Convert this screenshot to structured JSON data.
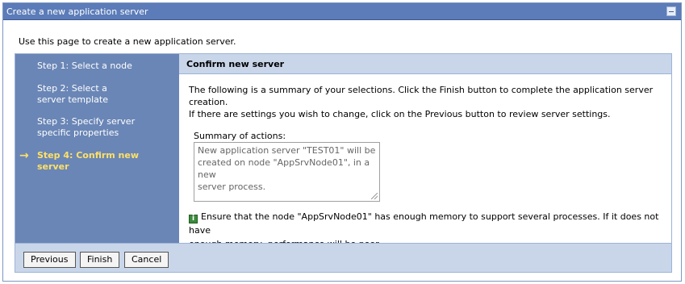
{
  "window": {
    "title": "Create a new application server"
  },
  "intro": "Use this page to create a new application server.",
  "steps": [
    {
      "label_line1": "Step 1: Select a node",
      "label_line2": ""
    },
    {
      "label_line1": "Step 2: Select a",
      "label_line2": "server template"
    },
    {
      "label_line1": "Step 3: Specify server",
      "label_line2": "specific properties"
    },
    {
      "label_line1": "Step 4: Confirm new",
      "label_line2": "server"
    }
  ],
  "current_step_arrow": "→",
  "panel": {
    "heading": "Confirm new server",
    "summary_line1": "The following is a summary of your selections. Click the Finish button to complete the application server creation.",
    "summary_line2": "If there are settings you wish to change, click on the Previous button to review server settings.",
    "summary_label": "Summary of actions:",
    "summary_actions_line1": "New application server \"TEST01\" will be",
    "summary_actions_line2": "created on node \"AppSrvNode01\", in a new",
    "summary_actions_line3": "server process.",
    "info_line1": "Ensure that the node \"AppSrvNode01\" has enough memory to support several processes. If it does not have",
    "info_line2": "enough memory, performance will be poor."
  },
  "buttons": {
    "previous": "Previous",
    "finish": "Finish",
    "cancel": "Cancel"
  },
  "colors": {
    "titlebar": "#5b7cb8",
    "steps_panel": "#6a86b6",
    "current_step": "#ffe066",
    "header_band": "#c9d6ea"
  }
}
